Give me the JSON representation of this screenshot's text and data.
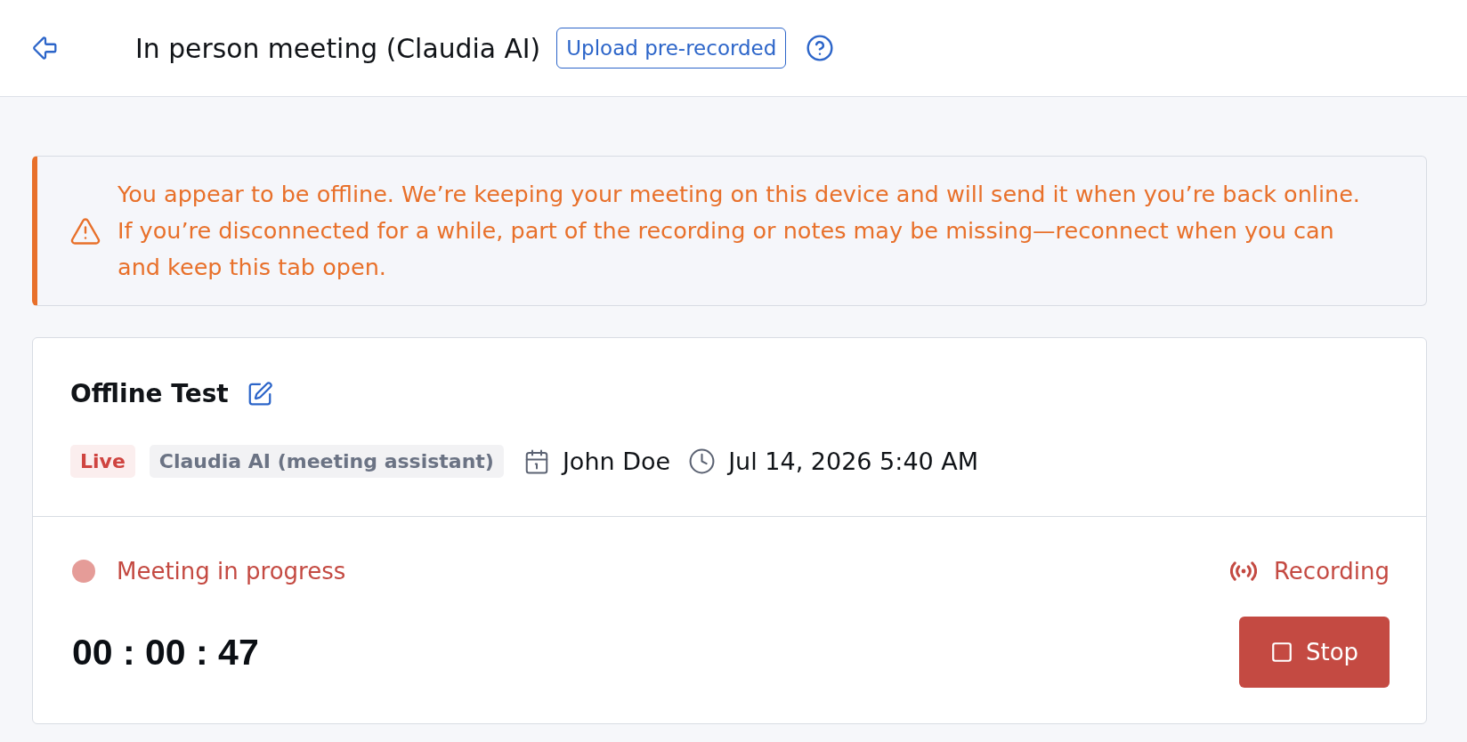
{
  "header": {
    "title": "In person meeting (Claudia AI)",
    "upload_button": "Upload pre-recorded"
  },
  "alert": {
    "kind": "warning",
    "message": "You appear to be offline. We’re keeping your meeting on this device and will send it when you’re back online. If you’re disconnected for a while, part of the recording or notes may be missing—reconnect when you can and keep this tab open."
  },
  "meeting": {
    "title": "Offline Test",
    "tags": [
      {
        "label": "Live",
        "color": "#cf4440"
      },
      {
        "label": "Claudia AI (meeting assistant)",
        "color": "#6b7384"
      }
    ],
    "organizer": "John Doe",
    "datetime": "Jul 14, 2026 5:40 AM"
  },
  "session": {
    "status": "Meeting in progress",
    "recording": "Recording",
    "timer": "00 : 00 : 47",
    "stop_button": "Stop"
  }
}
